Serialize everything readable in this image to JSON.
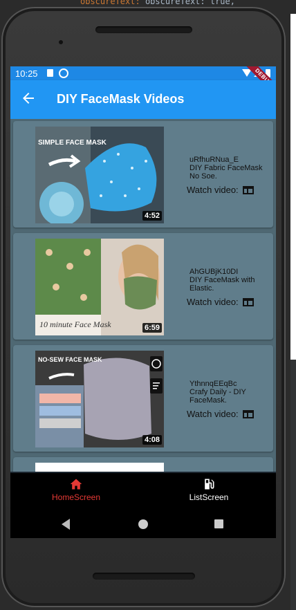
{
  "ide": {
    "code_fragment": "obscureText: true,"
  },
  "status_bar": {
    "time": "10:25",
    "debug_label": "DEBUG"
  },
  "app_bar": {
    "title": "DIY FaceMask Videos",
    "back_icon": "arrow-back-icon"
  },
  "videos": [
    {
      "thumb_caption": "SIMPLE FACE MASK",
      "duration": "4:52",
      "id": "uRfhuRNua_E",
      "title": "DIY Fabric FaceMask No Soe.",
      "watch_label": "Watch video:",
      "watch_icon": "web-icon"
    },
    {
      "thumb_caption": "10 minute Face Mask",
      "duration": "6:59",
      "id": "AhGUBjK10DI",
      "title": "DIY FaceMask with Elastic.",
      "watch_label": "Watch video:",
      "watch_icon": "web-icon"
    },
    {
      "thumb_caption": "NO-SEW FACE MASK",
      "duration": "4:08",
      "id": "YthnnqEEqBc",
      "title": "Crafy Daily - DIY FaceMask.",
      "watch_label": "Watch video:",
      "watch_icon": "web-icon"
    }
  ],
  "bottom_nav": {
    "items": [
      {
        "label": "HomeScreen",
        "icon": "home-icon",
        "active": true
      },
      {
        "label": "ListScreen",
        "icon": "gas-station-icon",
        "active": false
      }
    ]
  },
  "colors": {
    "primary": "#2196f3",
    "card": "#607d8b",
    "active_nav": "#e53935"
  }
}
